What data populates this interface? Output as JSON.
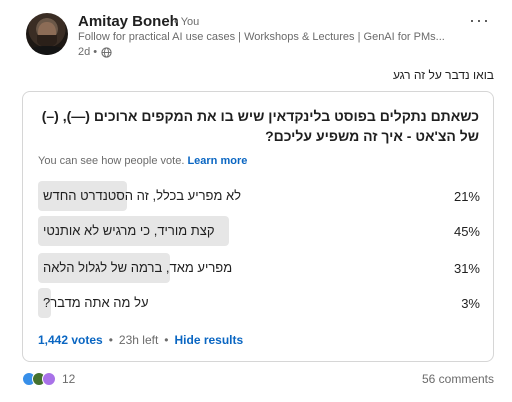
{
  "author": {
    "name": "Amitay Boneh",
    "relation": "• You",
    "tagline": "Follow for practical AI use cases | Workshops & Lectures | GenAI for PMs...",
    "age": "2d •",
    "visibility_icon": "globe-icon"
  },
  "post": {
    "text": "בואו נדבר על זה רגע"
  },
  "poll": {
    "question": "כשאתם נתקלים בפוסט בלינקדאין שיש בו את המקפים ארוכים (—), (–) של הצ'אט - איך זה משפיע עליכם?",
    "visibility_note": "You can see how people vote.",
    "learn_more": "Learn more",
    "options": [
      {
        "label": "לא מפריע בכלל, זה הסטנדרט החדש",
        "percent_label": "21%",
        "percent": 21
      },
      {
        "label": "קצת מוריד, כי מרגיש לא אותנטי",
        "percent_label": "45%",
        "percent": 45
      },
      {
        "label": "מפריע מאד, ברמה של לגלול הלאה",
        "percent_label": "31%",
        "percent": 31
      },
      {
        "label": "על מה אתה מדבר?",
        "percent_label": "3%",
        "percent": 3
      }
    ],
    "votes": "1,442 votes",
    "time_left": "23h left",
    "hide_results": "Hide results"
  },
  "social": {
    "reaction_icons": [
      "like-icon",
      "celebrate-icon",
      "support-icon"
    ],
    "reaction_count": "12",
    "comments": "56 comments"
  },
  "colors": {
    "link": "#0a66c2",
    "bar": "#e6e6e6",
    "muted_text": "#6b6b6b"
  }
}
